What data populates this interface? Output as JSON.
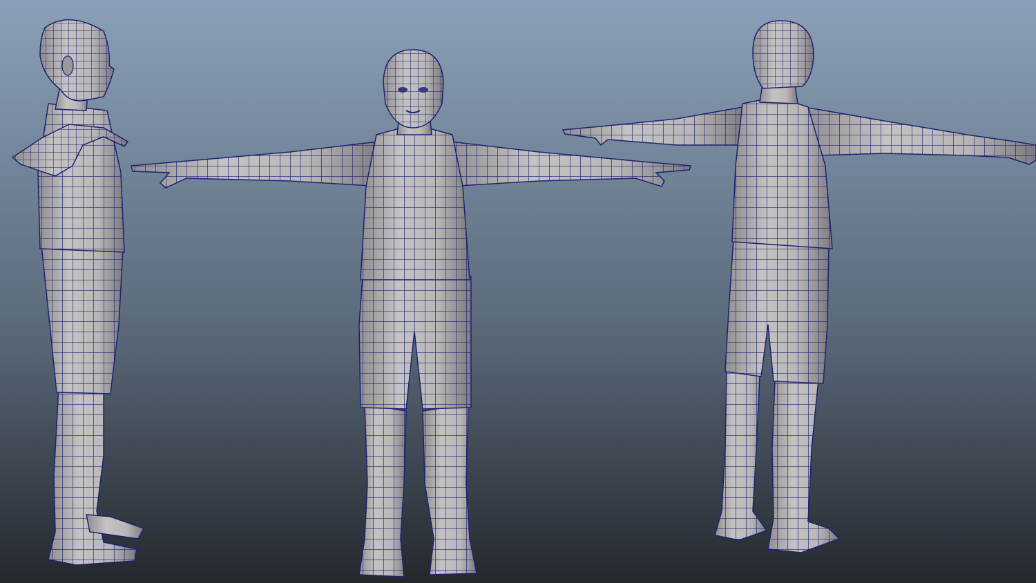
{
  "viewport": {
    "bg_top": "#8aa0b8",
    "bg_bottom": "#24282d"
  },
  "figures": [
    {
      "name": "side-view",
      "icon": "character-side-icon"
    },
    {
      "name": "front-view",
      "icon": "character-front-icon"
    },
    {
      "name": "back-view",
      "icon": "character-back-icon"
    }
  ],
  "material": {
    "surface_color": "#b8b6b6",
    "wire_color": "#1c2273"
  }
}
